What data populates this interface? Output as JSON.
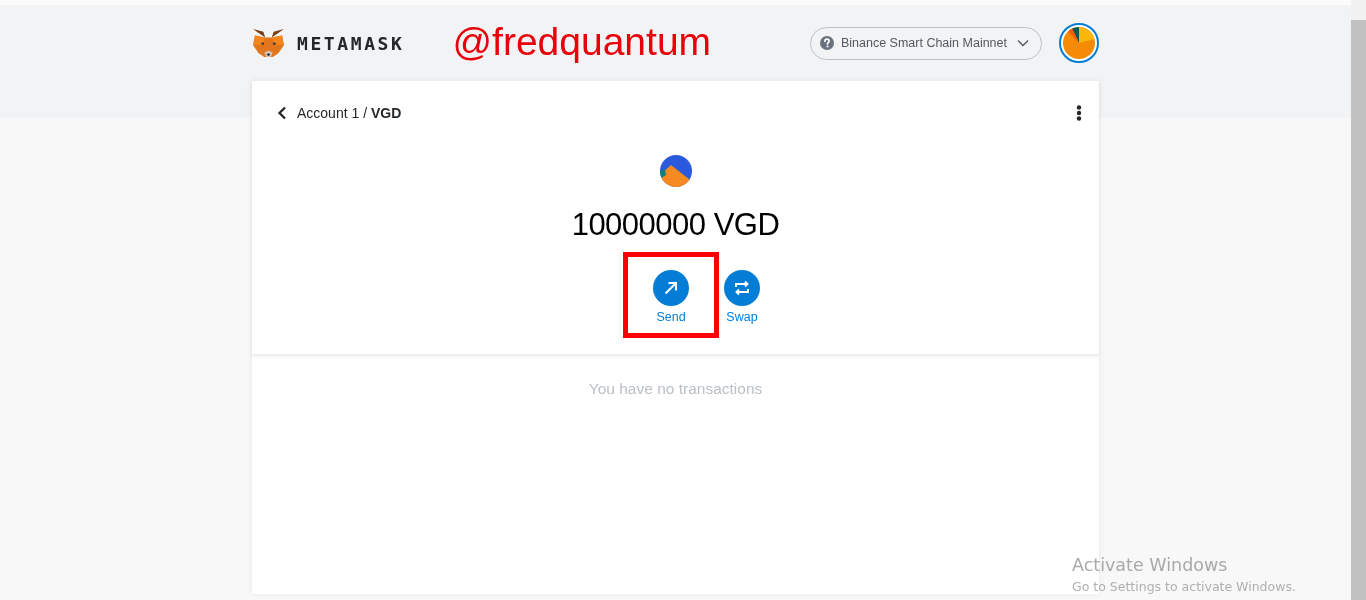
{
  "header": {
    "logo_text": "METAMASK",
    "annotation": "@fredquantum",
    "network": "Binance Smart Chain Mainnet"
  },
  "breadcrumb": "Account 1 / **VGD**",
  "token": {
    "balance": "10000000 VGD"
  },
  "actions": [
    {
      "kind": "send",
      "label": "Send",
      "highlighted": true
    },
    {
      "kind": "swap",
      "label": "Swap",
      "highlighted": false
    }
  ],
  "transactions": {
    "empty_message": "You have no transactions"
  },
  "os_notice": {
    "title": "Activate Windows",
    "subtitle": "Go to Settings to activate Windows."
  }
}
